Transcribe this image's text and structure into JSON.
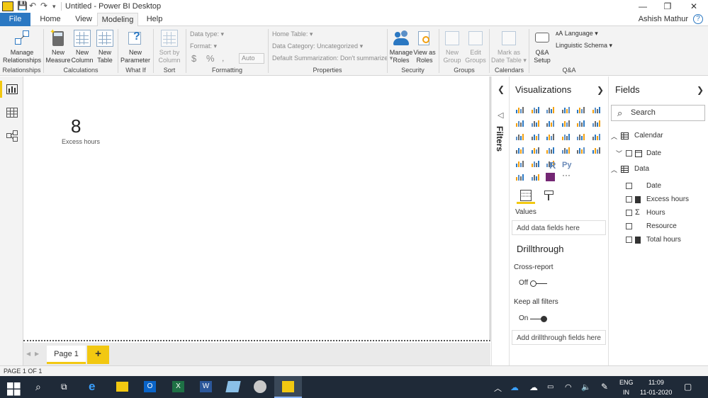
{
  "window": {
    "title": "Untitled - Power BI Desktop",
    "user": "Ashish Mathur",
    "help": "?",
    "controls": {
      "minimize": "—",
      "maximize": "❐",
      "close": "✕"
    }
  },
  "tabs": [
    {
      "label": "File"
    },
    {
      "label": "Home"
    },
    {
      "label": "View"
    },
    {
      "label": "Modeling"
    },
    {
      "label": "Help"
    }
  ],
  "ribbon": {
    "manage_relationships": "Manage Relationships",
    "new_measure": "New Measure",
    "new_column": "New Column",
    "new_table": "New Table",
    "new_parameter": "New Parameter",
    "sort_by_column": "Sort by Column",
    "data_type": "Data type:",
    "format": "Format:",
    "currency": "$",
    "percent": "%",
    "comma": ",",
    "auto": "Auto",
    "home_table": "Home Table:",
    "data_category": "Data Category: Uncategorized",
    "default_summarization": "Default Summarization: Don't summarize",
    "manage_roles": "Manage Roles",
    "view_as_roles": "View as Roles",
    "new_group": "New Group",
    "edit_groups": "Edit Groups",
    "mark_as_date_table": "Mark as Date Table",
    "qa_setup": "Q&A Setup",
    "language": "Language",
    "linguistic_schema": "Linguistic Schema",
    "groups": {
      "relationships": "Relationships",
      "calculations": "Calculations",
      "what_if": "What If",
      "sort": "Sort",
      "formatting": "Formatting",
      "properties": "Properties",
      "security": "Security",
      "groups": "Groups",
      "calendars": "Calendars",
      "qa": "Q&A"
    }
  },
  "canvas": {
    "card_value": "8",
    "card_label": "Excess hours"
  },
  "pages": {
    "page1": "Page 1",
    "add": "+"
  },
  "status": "PAGE 1 OF 1",
  "filters_label": "Filters",
  "visualizations": {
    "title": "Visualizations",
    "values_label": "Values",
    "add_data_fields": "Add data fields here",
    "drillthrough": "Drillthrough",
    "cross_report": "Cross-report",
    "cross_report_state": "Off",
    "keep_all_filters": "Keep all filters",
    "keep_all_filters_state": "On",
    "add_drillthrough_fields": "Add drillthrough fields here",
    "r_icon": "R",
    "py_icon": "Py",
    "more": "···"
  },
  "fields": {
    "title": "Fields",
    "search_placeholder": "Search",
    "tables": [
      {
        "name": "Calendar",
        "fields": [
          {
            "name": "Date"
          }
        ]
      },
      {
        "name": "Data",
        "fields": [
          {
            "name": "Date"
          },
          {
            "name": "Excess hours"
          },
          {
            "name": "Hours"
          },
          {
            "name": "Resource"
          },
          {
            "name": "Total hours"
          }
        ]
      }
    ]
  },
  "taskbar": {
    "language": "ENG",
    "region": "IN",
    "time": "11:09",
    "date": "11-01-2020"
  },
  "colors": {
    "accent": "#f2c811",
    "file_tab": "#2b78c2",
    "taskbar": "#1f2a38"
  }
}
